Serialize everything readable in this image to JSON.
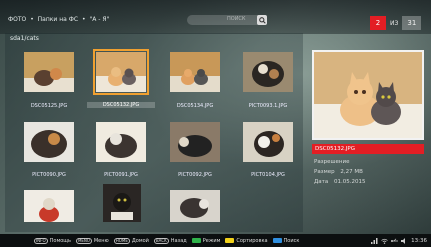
{
  "breadcrumb": {
    "part1": "ФОТО",
    "sep1": "•",
    "part2": "Папки на ФС",
    "sep2": "•",
    "part3": "\"А - Я\""
  },
  "search": {
    "placeholder": "ПОИСК"
  },
  "pager": {
    "current": "2",
    "of": "ИЗ",
    "total": "31"
  },
  "path": "sda1/cats",
  "thumbnails": [
    {
      "caption": "DSC05125.JPG",
      "selected": false
    },
    {
      "caption": "DSC05132.JPG",
      "selected": true
    },
    {
      "caption": "DSC05134.JPG",
      "selected": false
    },
    {
      "caption": "PICT0093.1.JPG",
      "selected": false
    },
    {
      "caption": "PICT0090.JPG",
      "selected": false
    },
    {
      "caption": "PICT0091.JPG",
      "selected": false
    },
    {
      "caption": "PICT0092.JPG",
      "selected": false
    },
    {
      "caption": "PICT0104.JPG",
      "selected": false
    },
    {
      "caption": "",
      "selected": false
    },
    {
      "caption": "",
      "selected": false
    },
    {
      "caption": "",
      "selected": false
    }
  ],
  "preview": {
    "filename": "DSC05132.JPG",
    "resolution_label": "Разрешение",
    "size_label": "Размер",
    "size_value": "2,27 MB",
    "date_label": "Дата",
    "date_value": "01.05.2015"
  },
  "bottom": {
    "items": [
      {
        "key": "INFO",
        "label": "Помощь"
      },
      {
        "key": "MENU",
        "label": "Меню"
      },
      {
        "key": "HOME",
        "label": "Домой"
      },
      {
        "key": "BACK",
        "label": "Назад"
      },
      {
        "color": "#2fb34a",
        "label": "Режим"
      },
      {
        "color": "#f2d21a",
        "label": "Сортировка"
      },
      {
        "color": "#2f8fe0",
        "label": "Поиск"
      }
    ],
    "clock": "13:36"
  },
  "colors": {
    "accent": "#e31e24",
    "selection": "#f0a030"
  }
}
